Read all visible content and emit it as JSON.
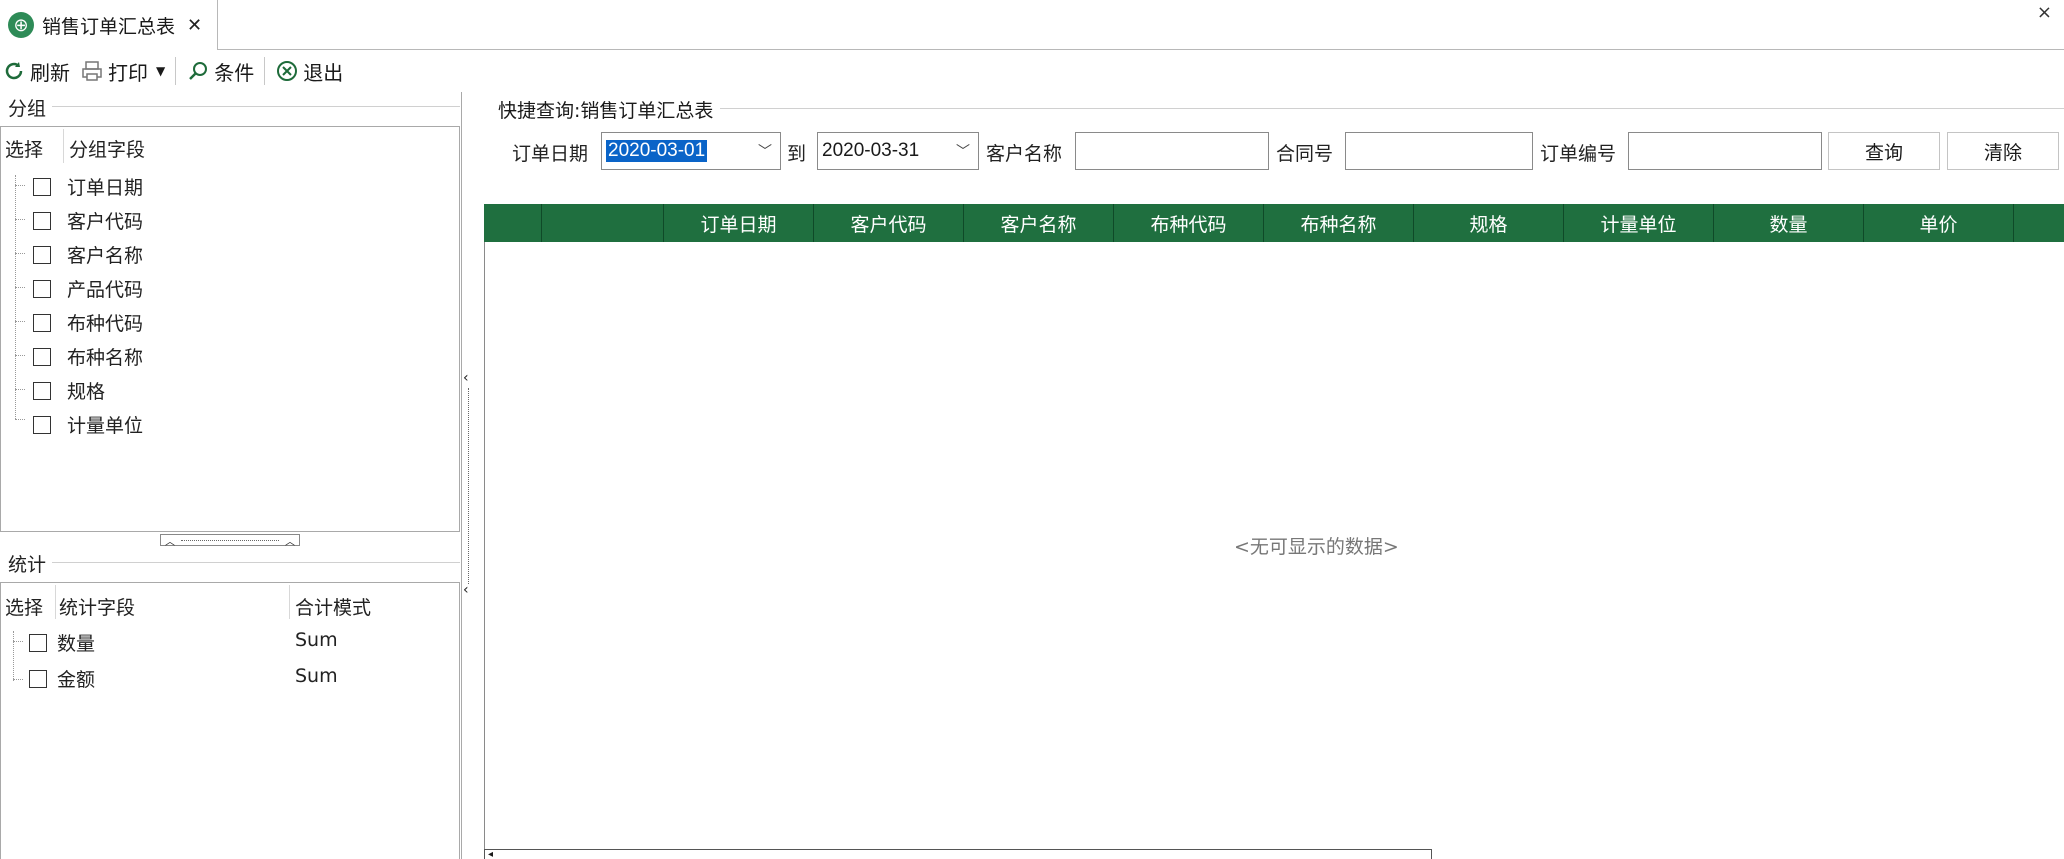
{
  "tab": {
    "title": "销售订单汇总表",
    "icon": "globe-icon",
    "close": "✕"
  },
  "window": {
    "close": "×"
  },
  "toolbar": {
    "refresh": "刷新",
    "print": "打印",
    "condition": "条件",
    "exit": "退出"
  },
  "group_section": {
    "title": "分组",
    "col_select": "选择",
    "col_field": "分组字段",
    "items": [
      "订单日期",
      "客户代码",
      "客户名称",
      "产品代码",
      "布种代码",
      "布种名称",
      "规格",
      "计量单位"
    ]
  },
  "stats_section": {
    "title": "统计",
    "col_select": "选择",
    "col_field": "统计字段",
    "col_mode": "合计模式",
    "items": [
      {
        "field": "数量",
        "mode": "Sum"
      },
      {
        "field": "金额",
        "mode": "Sum"
      }
    ]
  },
  "quick_query": {
    "title": "快捷查询:销售订单汇总表",
    "order_date_label": "订单日期",
    "date_from": "2020-03-01",
    "to_label": "到",
    "date_to": "2020-03-31",
    "customer_name_label": "客户名称",
    "customer_name_value": "",
    "contract_label": "合同号",
    "contract_value": "",
    "order_no_label": "订单编号",
    "order_no_value": "",
    "query_button": "查询",
    "clear_button": "清除"
  },
  "grid": {
    "columns": [
      "",
      "",
      "订单日期",
      "客户代码",
      "客户名称",
      "布种代码",
      "布种名称",
      "规格",
      "计量单位",
      "数量",
      "单价",
      ""
    ],
    "empty_text": "<无可显示的数据>"
  },
  "colors": {
    "grid_header": "#1f6f3f",
    "selection": "#0a64c8"
  }
}
